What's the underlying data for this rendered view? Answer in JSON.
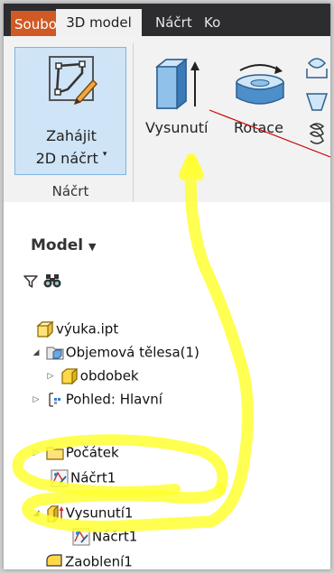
{
  "tabs": [
    {
      "label": "Soubor"
    },
    {
      "label": "3D model"
    },
    {
      "label": "Náčrt"
    },
    {
      "label": "Ko"
    }
  ],
  "ribbon": {
    "start_sketch_line1": "Zahájit",
    "start_sketch_line2": "2D náčrt",
    "sketch_panel_label": "Náčrt",
    "extrude_label": "Vysunutí",
    "revolve_label": "Rotace"
  },
  "browser": {
    "header": "Model",
    "tree": [
      {
        "label": "výuka.ipt",
        "icon": "part-icon"
      },
      {
        "label": "Objemová tělesa(1)",
        "icon": "solid-bodies-icon",
        "expander": "◢"
      },
      {
        "label": "obdobek",
        "icon": "solid-body-icon",
        "expander": "▷"
      },
      {
        "label": "Pohled: Hlavní",
        "icon": "view-icon",
        "expander": "▷"
      },
      {
        "label": "Počátek",
        "icon": "folder-icon",
        "expander": "▷"
      },
      {
        "label": "Náčrt1",
        "icon": "sketch-icon"
      },
      {
        "label": "Vysunutí1",
        "icon": "extrude-feature-icon",
        "expander": "◢"
      },
      {
        "label": "Náčrt1",
        "icon": "sketch-icon"
      },
      {
        "label": "Zaoblení1",
        "icon": "fillet-icon"
      }
    ]
  },
  "colors": {
    "file_tab": "#d05a26",
    "tab_bar": "#2d2d30",
    "highlight": "#ffff33",
    "pointer_line": "#cc0000"
  }
}
